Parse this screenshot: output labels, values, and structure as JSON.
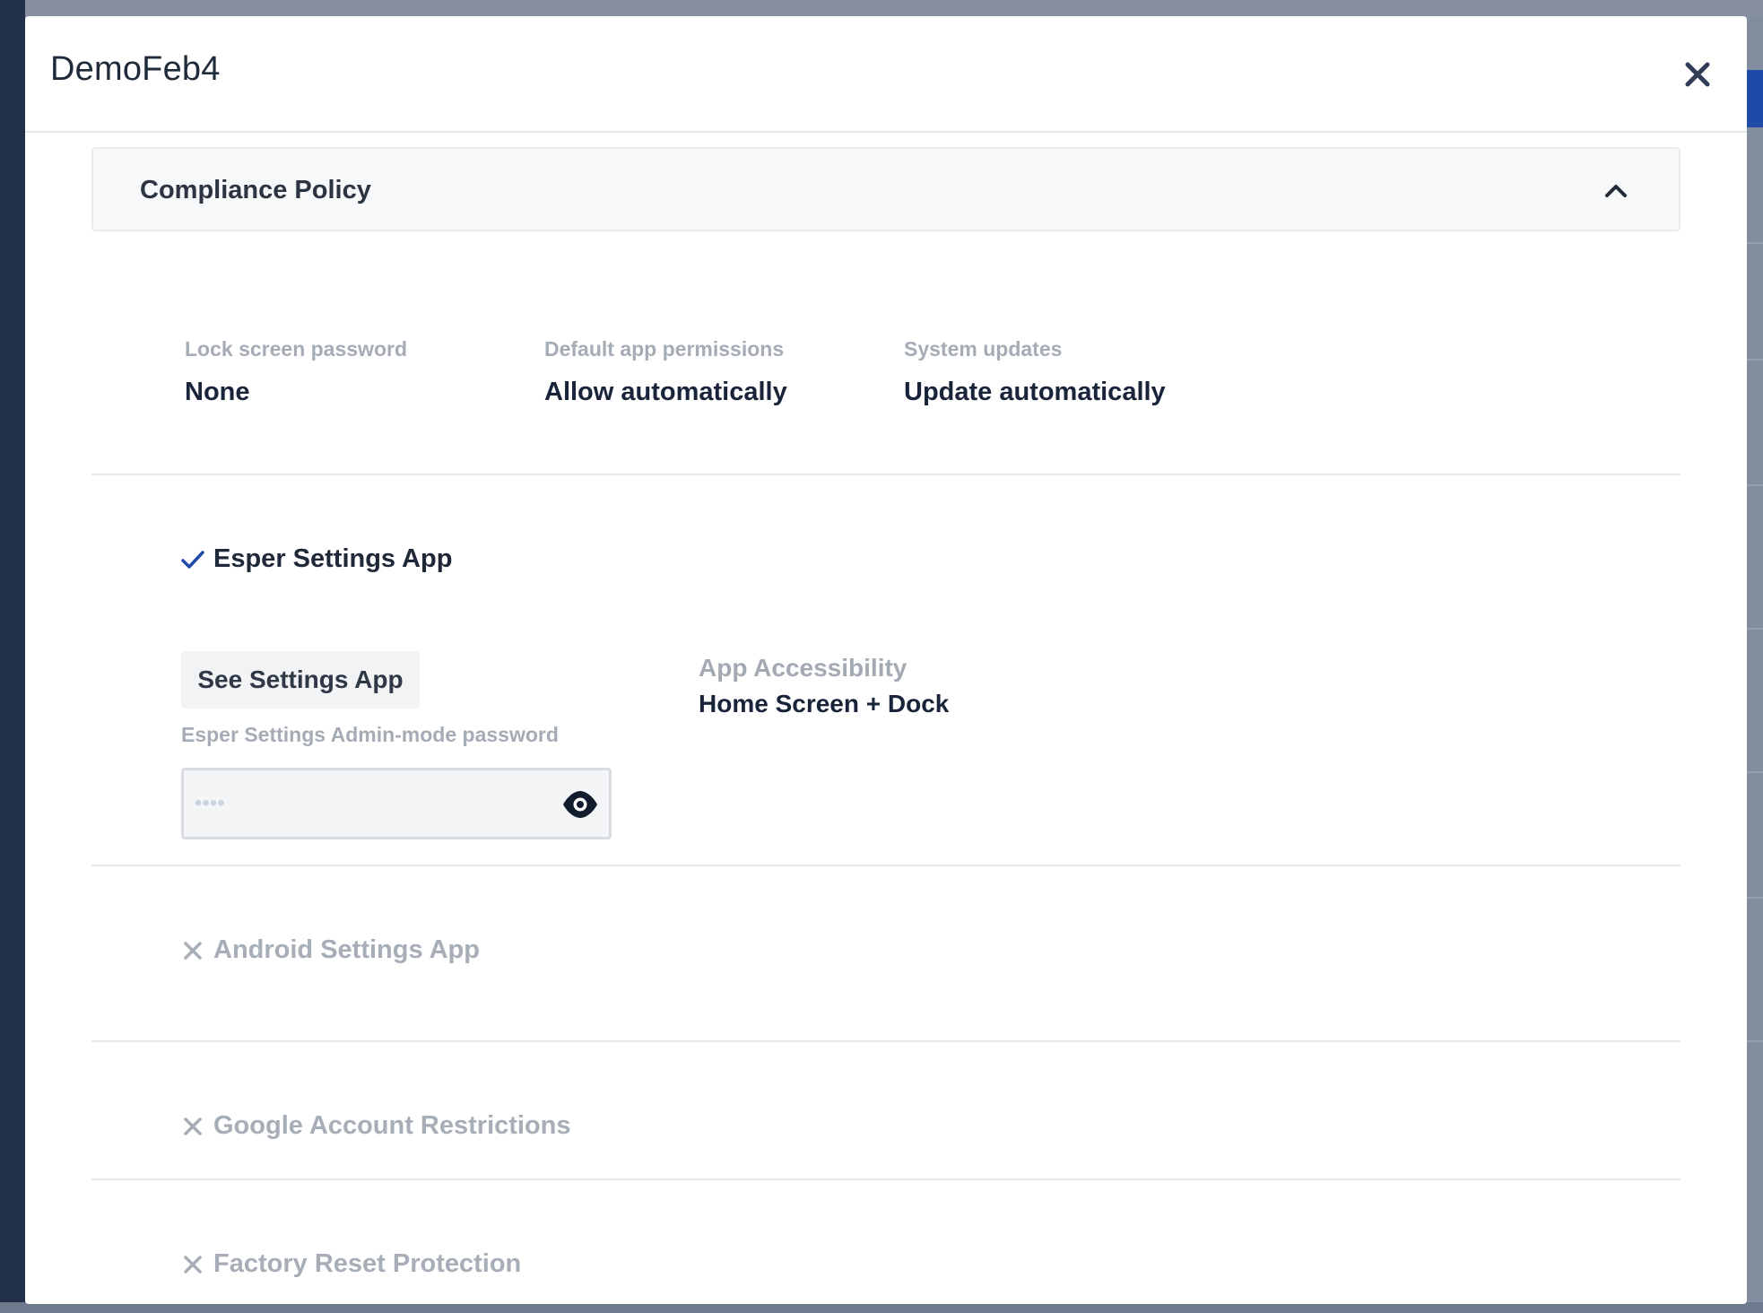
{
  "modal": {
    "title": "DemoFeb4"
  },
  "section": {
    "title": "Compliance Policy"
  },
  "policy_fields": [
    {
      "label": "Lock screen password",
      "value": "None"
    },
    {
      "label": "Default app permissions",
      "value": "Allow automatically"
    },
    {
      "label": "System updates",
      "value": "Update automatically"
    }
  ],
  "esper_settings": {
    "label": "Esper Settings App",
    "enabled": true,
    "see_button_label": "See Settings App",
    "password_label": "Esper Settings Admin-mode password",
    "password_value": "••••",
    "accessibility_label": "App Accessibility",
    "accessibility_value": "Home Screen + Dock"
  },
  "disabled_items": [
    {
      "label": "Android Settings App",
      "enabled": false
    },
    {
      "label": "Google Account Restrictions",
      "enabled": false
    },
    {
      "label": "Factory Reset Protection",
      "enabled": false
    }
  ],
  "colors": {
    "accent": "#1f4aa8",
    "text_dark": "#19243a",
    "text_muted": "#a5acb6",
    "divider": "#e6e8ec"
  },
  "icons": {
    "close": "close-icon",
    "chevron": "chevron-up-icon",
    "check": "check-icon",
    "cross": "x-icon",
    "eye": "eye-icon"
  }
}
